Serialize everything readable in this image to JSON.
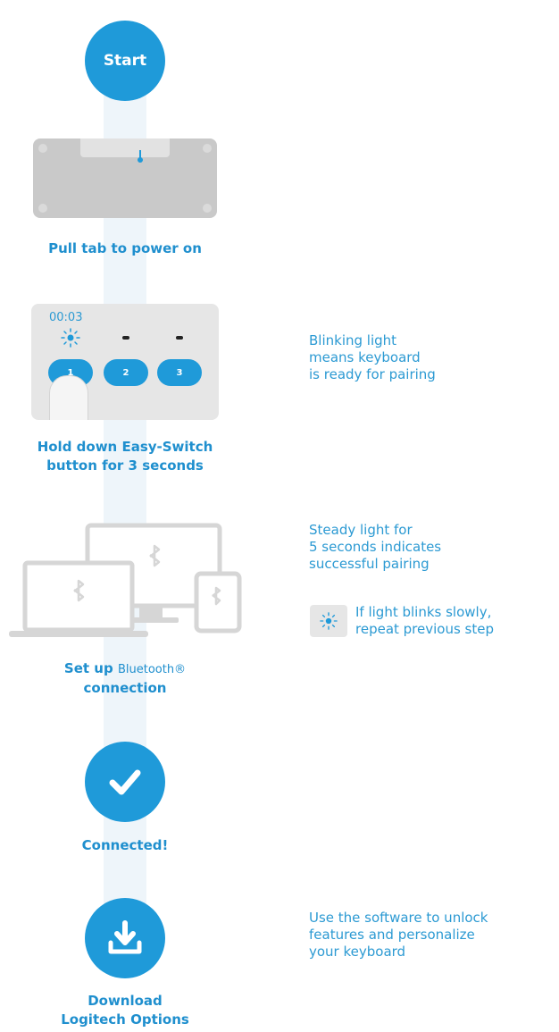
{
  "start": {
    "label": "Start"
  },
  "step1": {
    "label": "Pull tab to power on"
  },
  "step2": {
    "timer": "00:03",
    "buttons": [
      "1",
      "2",
      "3"
    ],
    "label_line1": "Hold down Easy-Switch",
    "label_line2": "button for 3 seconds",
    "note_line1": "Blinking light",
    "note_line2": "means keyboard",
    "note_line3": "is ready for pairing"
  },
  "step3": {
    "label_bold": "Set up",
    "label_light": "Bluetooth®",
    "label_line2": "connection",
    "note_line1": "Steady light for",
    "note_line2": "5 seconds indicates",
    "note_line3": "successful pairing",
    "hint_line1": "If light blinks slowly,",
    "hint_line2": "repeat previous step"
  },
  "step4": {
    "label": "Connected!"
  },
  "step5": {
    "label_line1": "Download",
    "label_line2": "Logitech Options",
    "note_line1": "Use the software to unlock",
    "note_line2": "features and personalize",
    "note_line3": "your keyboard"
  },
  "colors": {
    "accent": "#1f9ad9",
    "text_blue": "#1f8fce",
    "device_gray": "#d9d9d9",
    "track": "#eef5fa"
  }
}
